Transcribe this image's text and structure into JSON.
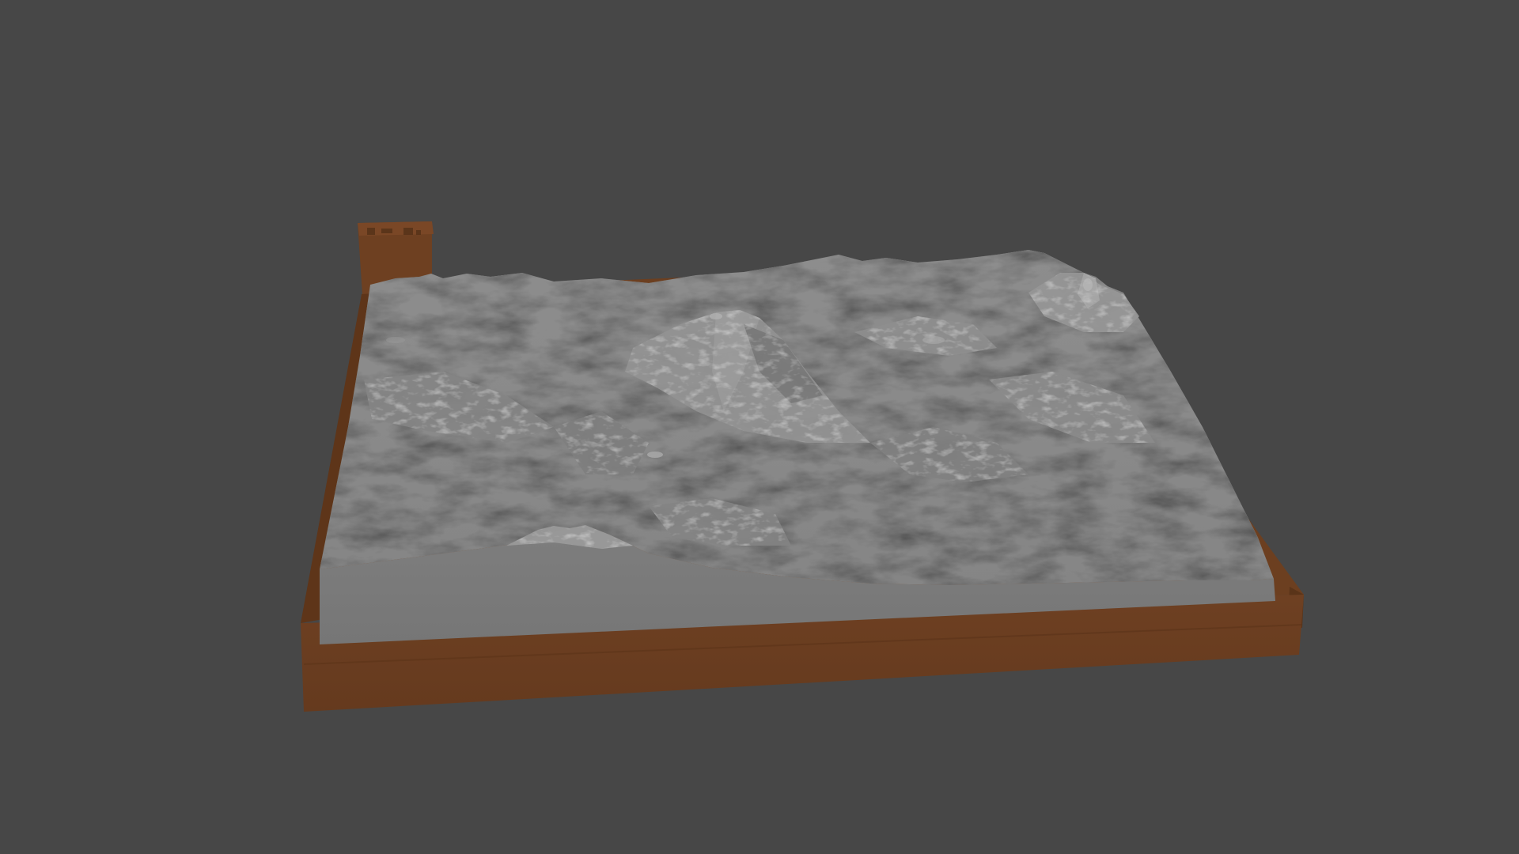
{
  "scene": {
    "background_color": "#474747",
    "base_color": "#6a3f20",
    "base_side_color": "#5a3419",
    "terrain_color": "#8a8a8a",
    "terrain_highlight_color": "#a3a3a3",
    "terrain_shadow_color": "#5f5f5f",
    "terrain_front_face_color": "#7c7c7c",
    "label_block_engraving": "",
    "objects": [
      {
        "name": "terrain-relief-model",
        "type": "3d-mesh"
      },
      {
        "name": "wooden-base-plinth",
        "type": "3d-mesh"
      },
      {
        "name": "label-block",
        "type": "3d-mesh"
      }
    ]
  }
}
